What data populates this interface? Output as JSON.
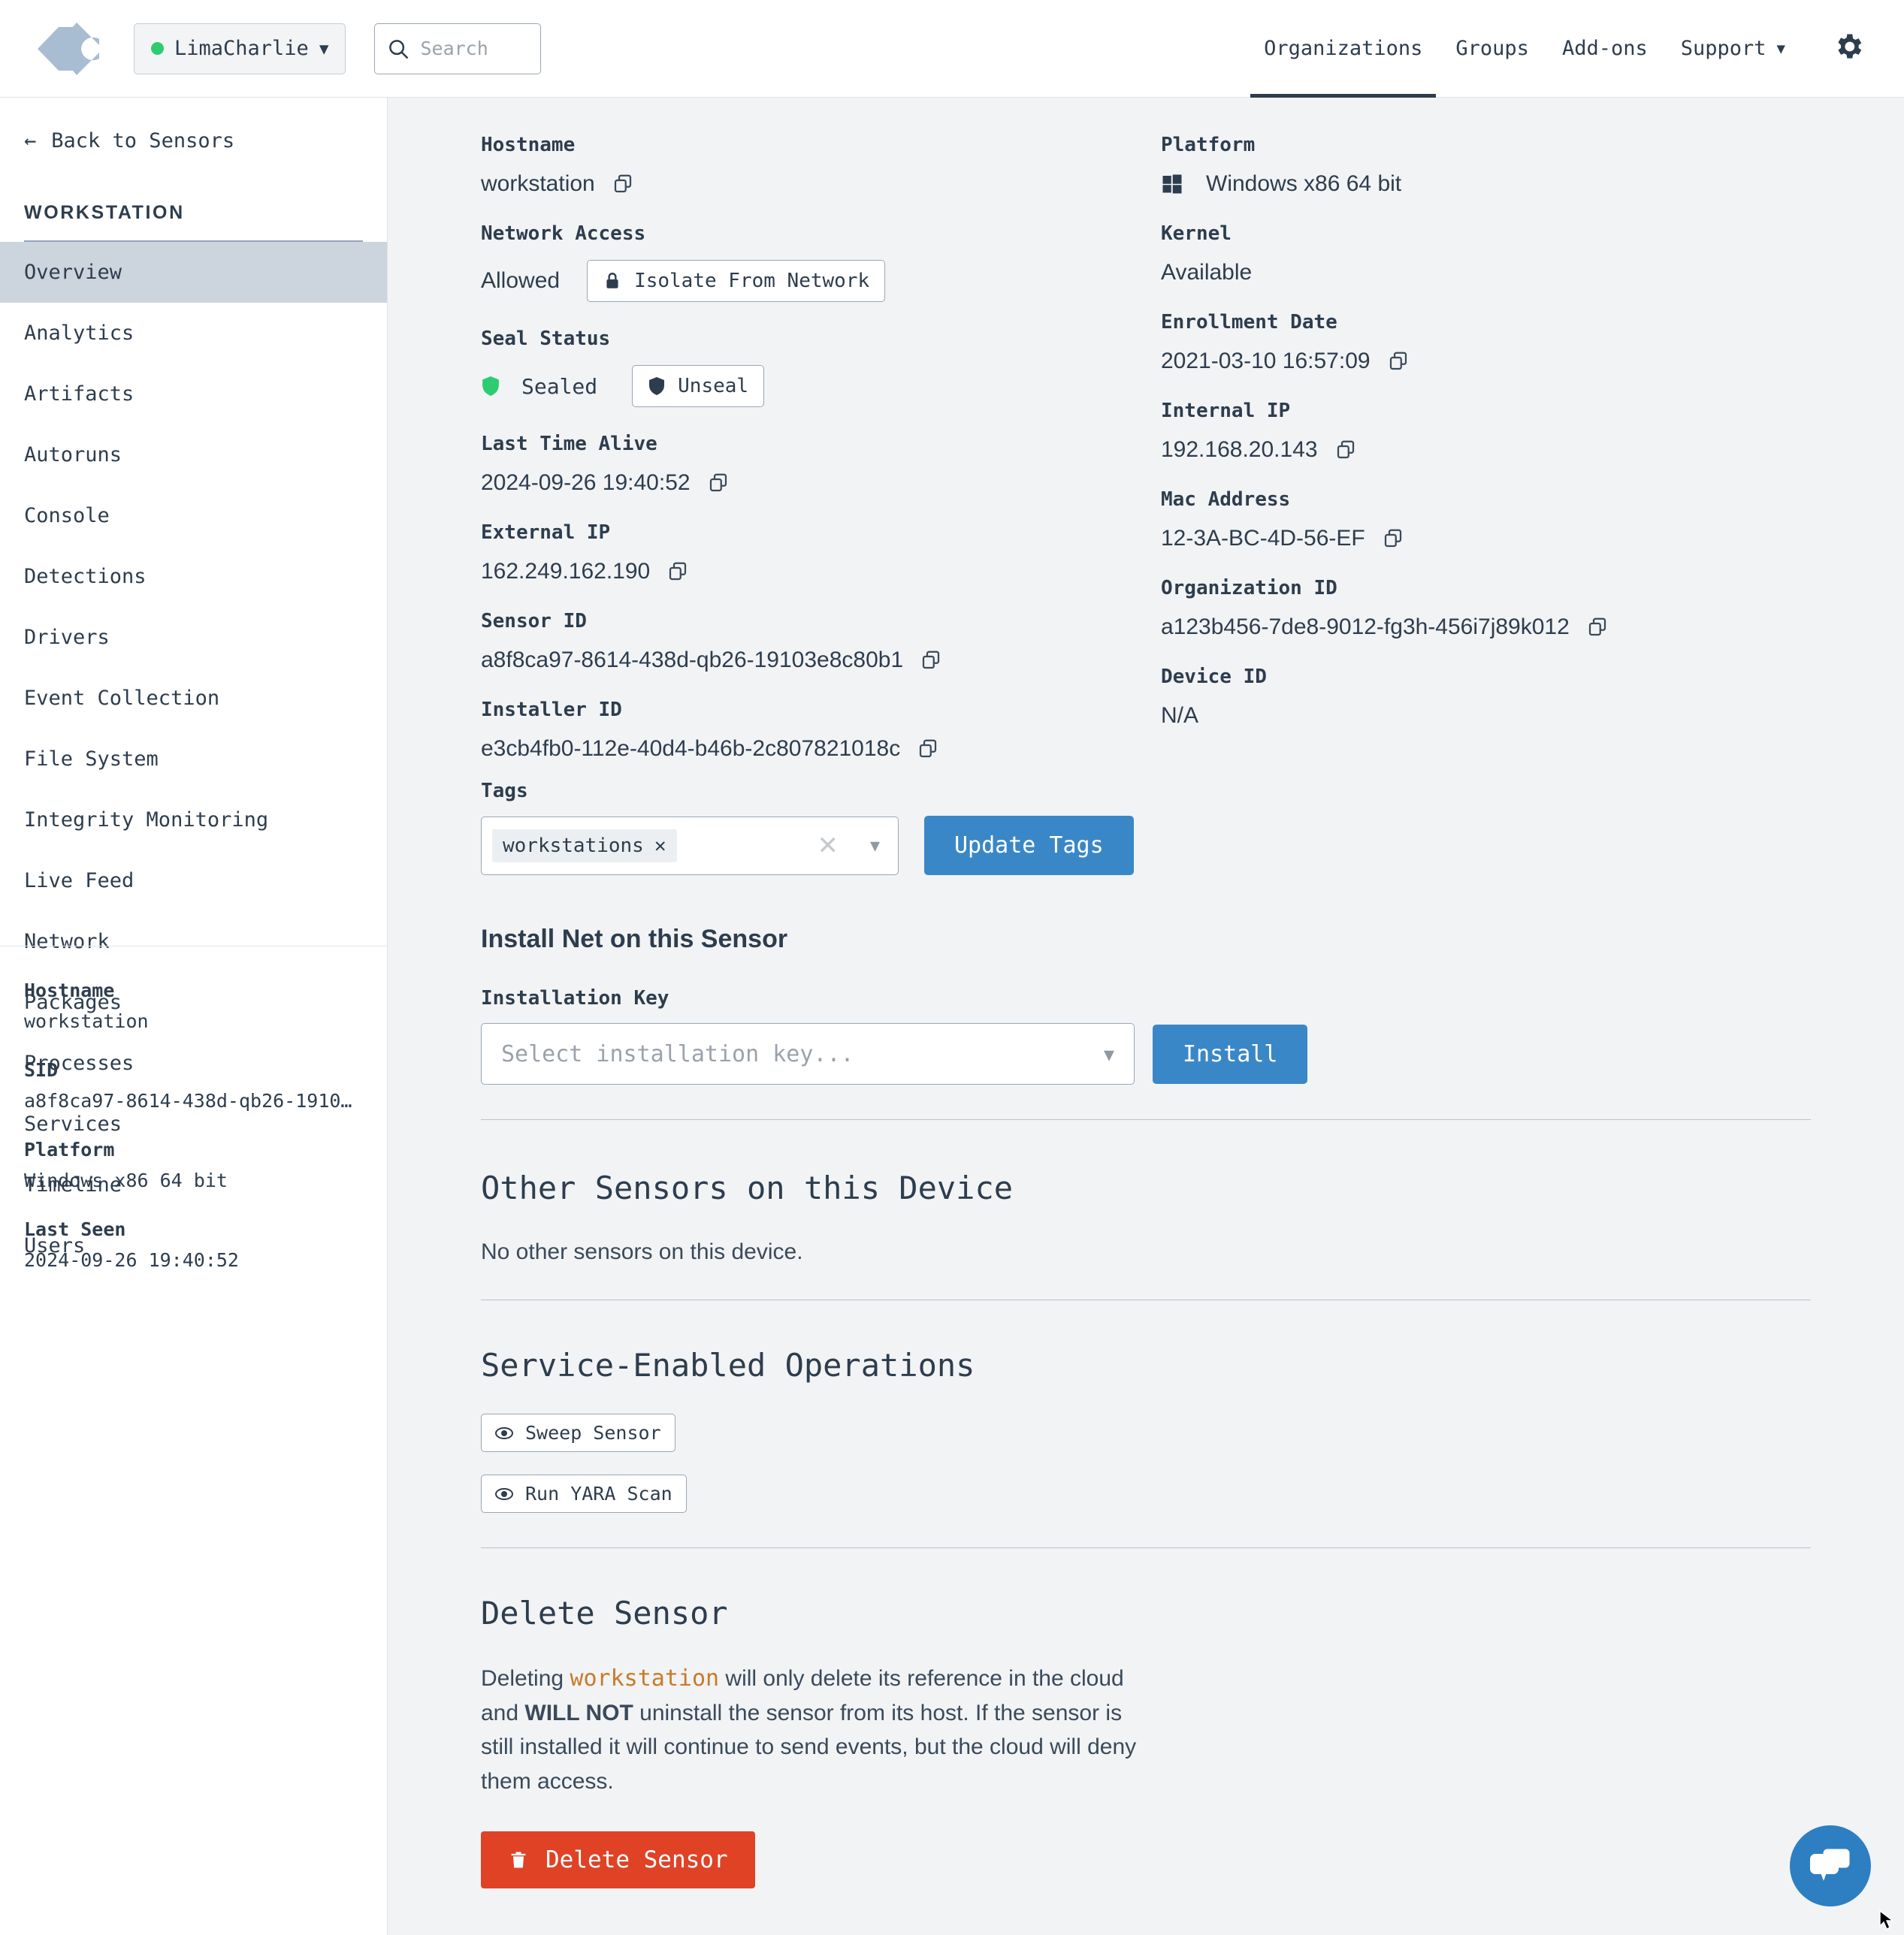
{
  "topbar": {
    "org_name": "LimaCharlie",
    "org_status_color": "#2ecc71",
    "search_placeholder": "Search",
    "nav": [
      {
        "label": "Organizations",
        "active": true
      },
      {
        "label": "Groups",
        "active": false
      },
      {
        "label": "Add-ons",
        "active": false
      },
      {
        "label": "Support",
        "active": false,
        "has_caret": true
      }
    ]
  },
  "sidebar": {
    "back_label": "Back to Sensors",
    "section_title": "WORKSTATION",
    "items": [
      {
        "label": "Overview",
        "selected": true
      },
      {
        "label": "Analytics",
        "selected": false
      },
      {
        "label": "Artifacts",
        "selected": false
      },
      {
        "label": "Autoruns",
        "selected": false
      },
      {
        "label": "Console",
        "selected": false
      },
      {
        "label": "Detections",
        "selected": false
      },
      {
        "label": "Drivers",
        "selected": false
      },
      {
        "label": "Event Collection",
        "selected": false
      },
      {
        "label": "File System",
        "selected": false
      },
      {
        "label": "Integrity Monitoring",
        "selected": false
      },
      {
        "label": "Live Feed",
        "selected": false
      },
      {
        "label": "Network",
        "selected": false
      },
      {
        "label": "Packages",
        "selected": false
      },
      {
        "label": "Processes",
        "selected": false
      },
      {
        "label": "Services",
        "selected": false
      },
      {
        "label": "Timeline",
        "selected": false
      },
      {
        "label": "Users",
        "selected": false
      }
    ],
    "footer": {
      "hostname_label": "Hostname",
      "hostname_value": "workstation",
      "sid_label": "SID",
      "sid_value": "a8f8ca97-8614-438d-qb26-1910…",
      "platform_label": "Platform",
      "platform_value": "Windows x86 64 bit",
      "last_seen_label": "Last Seen",
      "last_seen_value": "2024-09-26 19:40:52"
    }
  },
  "details": {
    "hostname_label": "Hostname",
    "hostname_value": "workstation",
    "platform_label": "Platform",
    "platform_value": "Windows x86 64 bit",
    "network_access_label": "Network Access",
    "network_access_value": "Allowed",
    "isolate_button": "Isolate From Network",
    "kernel_label": "Kernel",
    "kernel_value": "Available",
    "seal_status_label": "Seal Status",
    "seal_status_value": "Sealed",
    "unseal_button": "Unseal",
    "enrollment_date_label": "Enrollment Date",
    "enrollment_date_value": "2021-03-10 16:57:09",
    "last_time_alive_label": "Last Time Alive",
    "last_time_alive_value": "2024-09-26 19:40:52",
    "internal_ip_label": "Internal IP",
    "internal_ip_value": "192.168.20.143",
    "external_ip_label": "External IP",
    "external_ip_value": "162.249.162.190",
    "mac_address_label": "Mac Address",
    "mac_address_value": "12-3A-BC-4D-56-EF",
    "sensor_id_label": "Sensor ID",
    "sensor_id_value": "a8f8ca97-8614-438d-qb26-19103e8c80b1",
    "organization_id_label": "Organization ID",
    "organization_id_value": "a123b456-7de8-9012-fg3h-456i7j89k012",
    "installer_id_label": "Installer ID",
    "installer_id_value": "e3cb4fb0-112e-40d4-b46b-2c807821018c",
    "device_id_label": "Device ID",
    "device_id_value": "N/A"
  },
  "tags": {
    "label": "Tags",
    "chips": [
      "workstations"
    ],
    "update_button": "Update Tags"
  },
  "install_net": {
    "heading": "Install Net on this Sensor",
    "key_label": "Installation Key",
    "key_placeholder": "Select installation key...",
    "install_button": "Install"
  },
  "other_sensors": {
    "heading": "Other Sensors on this Device",
    "empty_text": "No other sensors on this device."
  },
  "service_ops": {
    "heading": "Service-Enabled Operations",
    "buttons": [
      "Sweep Sensor",
      "Run YARA Scan"
    ]
  },
  "delete_sensor": {
    "heading": "Delete Sensor",
    "text_1": "Deleting ",
    "text_host": "workstation",
    "text_2": " will only delete its reference in the cloud and ",
    "text_bold": "WILL NOT",
    "text_3": " uninstall the sensor from its host. If the sensor is still installed it will continue to send events, but the cloud will deny them access.",
    "button": "Delete Sensor"
  },
  "chat_widget": {
    "name": "chat-bubble",
    "color": "#2d7fc1"
  }
}
